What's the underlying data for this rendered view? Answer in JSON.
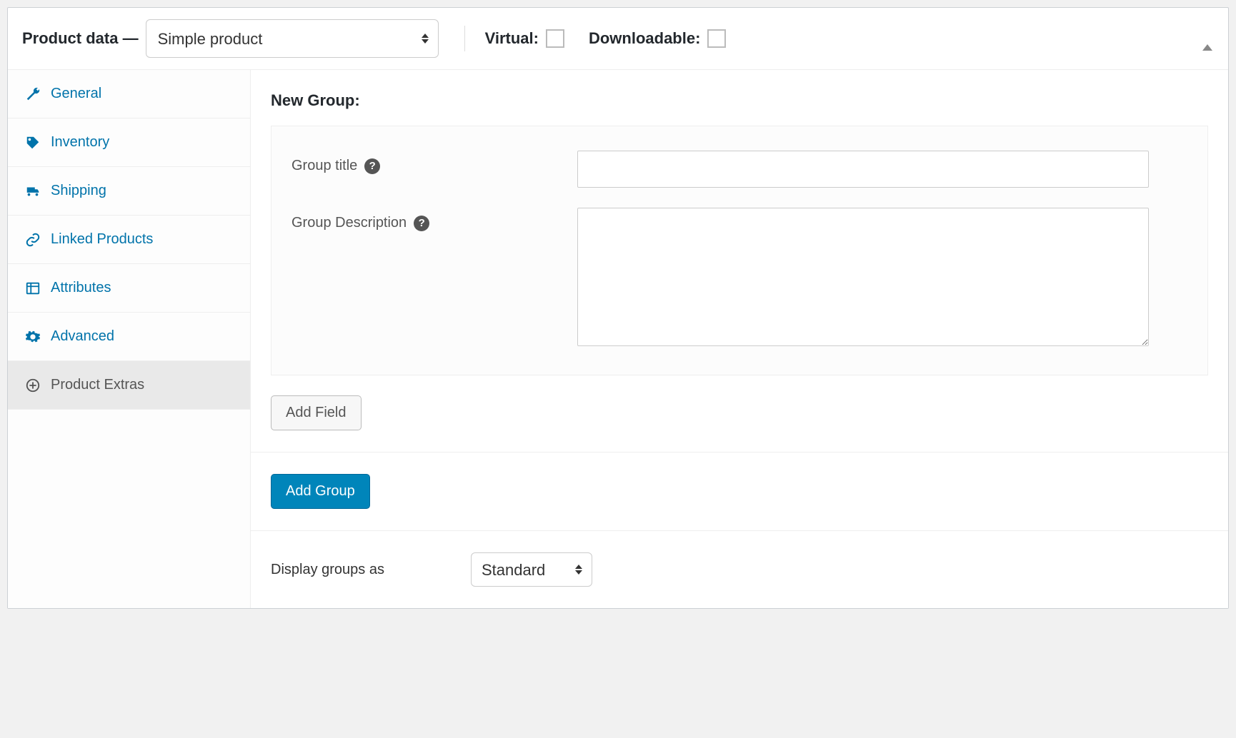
{
  "header": {
    "title": "Product data —",
    "product_type_selected": "Simple product",
    "virtual_label": "Virtual:",
    "downloadable_label": "Downloadable:"
  },
  "sidebar": {
    "items": [
      {
        "id": "general",
        "label": "General"
      },
      {
        "id": "inventory",
        "label": "Inventory"
      },
      {
        "id": "shipping",
        "label": "Shipping"
      },
      {
        "id": "linked-products",
        "label": "Linked Products"
      },
      {
        "id": "attributes",
        "label": "Attributes"
      },
      {
        "id": "advanced",
        "label": "Advanced"
      },
      {
        "id": "product-extras",
        "label": "Product Extras"
      }
    ]
  },
  "main": {
    "new_group_heading": "New Group:",
    "group_title_label": "Group title",
    "group_description_label": "Group Description",
    "add_field_label": "Add Field",
    "add_group_label": "Add Group",
    "display_groups_label": "Display groups as",
    "display_groups_selected": "Standard"
  }
}
